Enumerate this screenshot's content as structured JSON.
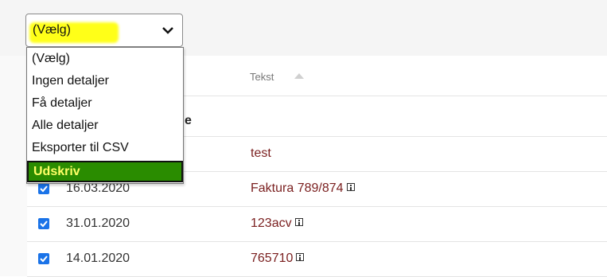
{
  "select": {
    "value": "(Vælg)",
    "options": [
      "(Vælg)",
      "Ingen detaljer",
      "Få detaljer",
      "Alle detaljer",
      "Eksporter til CSV",
      "Udskriv"
    ]
  },
  "table": {
    "header_text": "Tekst",
    "group_label_partial": "e",
    "rows": [
      {
        "date": "",
        "text": "test",
        "checked": true
      },
      {
        "date": "16.03.2020",
        "text": "Faktura 789/874",
        "checked": true
      },
      {
        "date": "31.01.2020",
        "text": "123acv",
        "checked": true
      },
      {
        "date": "14.01.2020",
        "text": "765710",
        "checked": true
      }
    ]
  },
  "colors": {
    "highlight": "#ffff00",
    "selected_bg": "#2a8c00",
    "checkbox": "#1a73e8",
    "link_text": "#7a1f1f"
  }
}
